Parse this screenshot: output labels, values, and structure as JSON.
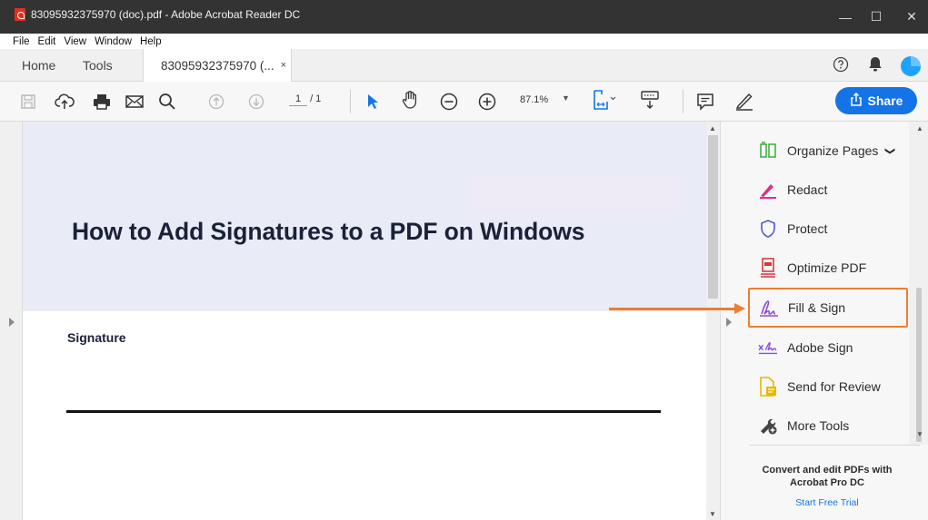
{
  "window": {
    "title": "83095932375970 (doc).pdf - Adobe Acrobat Reader DC",
    "minimize": "—",
    "maximize": "☐",
    "close": "✕"
  },
  "menu": [
    "File",
    "Edit",
    "View",
    "Window",
    "Help"
  ],
  "tabs": {
    "home": "Home",
    "tools": "Tools",
    "document": "83095932375970 (...",
    "document_close": "×"
  },
  "toolbar": {
    "page_current": "1",
    "page_total": "/ 1",
    "zoom": "87.1%",
    "zoom_caret": "▼",
    "share_label": "Share"
  },
  "document": {
    "heading": "How to Add Signatures to a PDF on Windows",
    "signature_label": "Signature"
  },
  "tools_panel": {
    "items": [
      {
        "label": "Organize Pages",
        "icon": "organize-pages-icon",
        "color": "#3cab3a"
      },
      {
        "label": "Redact",
        "icon": "redact-icon",
        "color": "#d9328a"
      },
      {
        "label": "Protect",
        "icon": "protect-icon",
        "color": "#5a5fd6"
      },
      {
        "label": "Optimize PDF",
        "icon": "optimize-pdf-icon",
        "color": "#d7373f"
      },
      {
        "label": "Fill & Sign",
        "icon": "fill-sign-icon",
        "color": "#8f4dd8"
      },
      {
        "label": "Adobe Sign",
        "icon": "adobe-sign-icon",
        "color": "#8f4dd8"
      },
      {
        "label": "Send for Review",
        "icon": "send-for-review-icon",
        "color": "#e8b700"
      },
      {
        "label": "More Tools",
        "icon": "more-tools-icon",
        "color": "#444444"
      }
    ],
    "organize_chevron": "❯",
    "promo_title": "Convert and edit PDFs with Acrobat Pro DC",
    "promo_link": "Start Free Trial"
  },
  "colors": {
    "accent_blue": "#1473e6",
    "annotation_orange": "#ed7d31",
    "titlebar": "#333333"
  }
}
